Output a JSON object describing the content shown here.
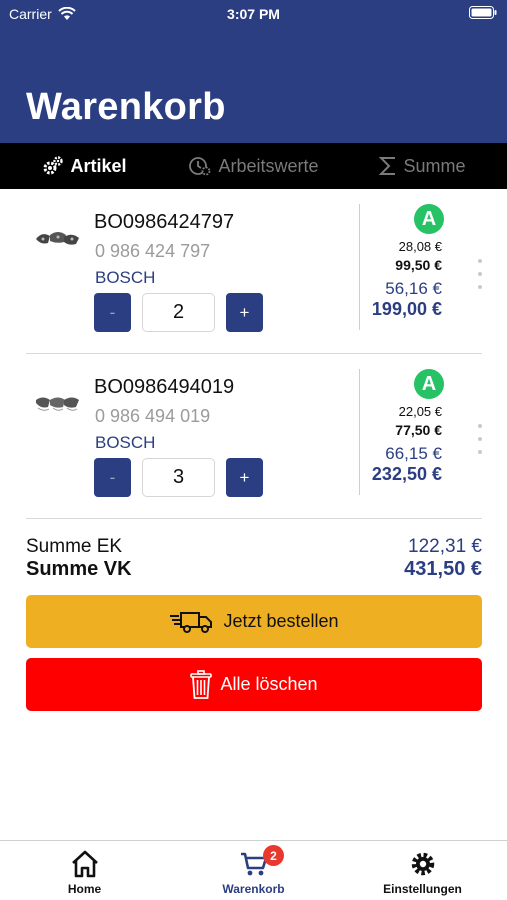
{
  "status_bar": {
    "carrier": "Carrier",
    "time": "3:07 PM"
  },
  "header": {
    "title": "Warenkorb"
  },
  "tabs": [
    {
      "label": "Artikel",
      "icon": "gears-icon",
      "active": true
    },
    {
      "label": "Arbeitswerte",
      "icon": "clock-gear-icon",
      "active": false
    },
    {
      "label": "Summe",
      "icon": "sigma-icon",
      "active": false
    }
  ],
  "items": [
    {
      "article_no": "BO0986424797",
      "ean": "0 986 424 797",
      "brand": "BOSCH",
      "qty": "2",
      "minus_label": "-",
      "plus_label": "+",
      "availability": "A",
      "ek_unit": "28,08 €",
      "vk_unit": "99,50 €",
      "ek_total": "56,16 €",
      "vk_total": "199,00 €"
    },
    {
      "article_no": "BO0986494019",
      "ean": "0 986 494 019",
      "brand": "BOSCH",
      "qty": "3",
      "minus_label": "-",
      "plus_label": "+",
      "availability": "A",
      "ek_unit": "22,05 €",
      "vk_unit": "77,50 €",
      "ek_total": "66,15 €",
      "vk_total": "232,50 €"
    }
  ],
  "summary": {
    "ek_label": "Summe EK",
    "ek_value": "122,31 €",
    "vk_label": "Summe VK",
    "vk_value": "431,50 €"
  },
  "actions": {
    "order_label": "Jetzt bestellen",
    "clear_label": "Alle löschen"
  },
  "bottom_nav": [
    {
      "label": "Home",
      "icon": "home-icon"
    },
    {
      "label": "Warenkorb",
      "icon": "cart-icon",
      "badge": "2",
      "active": true
    },
    {
      "label": "Einstellungen",
      "icon": "gear-icon"
    }
  ],
  "colors": {
    "primary": "#2c3e82",
    "availability_green": "#27c266",
    "order_button": "#eeaf22",
    "delete_button": "#ff0000",
    "badge": "#e8392f"
  }
}
